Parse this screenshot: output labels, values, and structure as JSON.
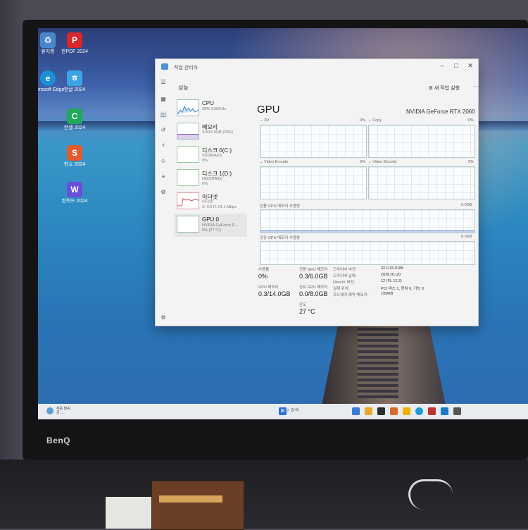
{
  "desktop": {
    "icons": [
      {
        "label": "휴지통",
        "icon": "recycle-bin-icon",
        "color": "#4c88c9"
      },
      {
        "label": "한PDF 2024",
        "icon": "pdf-icon",
        "color": "#d8262a"
      },
      {
        "label": "Microsoft Edge",
        "icon": "edge-icon",
        "color": "#1b8fd6"
      },
      {
        "label": "한글 2024",
        "icon": "hangul-icon",
        "color": "#3ba3e6"
      },
      {
        "label": "한셀 2024",
        "icon": "hancell-icon",
        "color": "#21a85b"
      },
      {
        "label": "한쇼 2024",
        "icon": "hanshow-icon",
        "color": "#e45b2b"
      },
      {
        "label": "한워드 2024",
        "icon": "hanword-icon",
        "color": "#6a4fd8"
      }
    ]
  },
  "window": {
    "title": "작업 관리자",
    "controls": [
      "–",
      "□",
      "✕"
    ],
    "page_heading": "성능",
    "run_task_label": "새 작업 실행",
    "more_label": "···"
  },
  "sidebar": {
    "items": [
      {
        "name": "CPU",
        "sub1": "29% 3.58GHz",
        "sub2": ""
      },
      {
        "name": "메모리",
        "sub1": "3.9/15.9GB (25%)",
        "sub2": ""
      },
      {
        "name": "디스크 0(C:)",
        "sub1": "SSD(RAID)",
        "sub2": "0%"
      },
      {
        "name": "디스크 1(D:)",
        "sub1": "HDD(RAID)",
        "sub2": "0%"
      },
      {
        "name": "이더넷",
        "sub1": "이더넷",
        "sub2": "S: 0.9 R: 61.1 Mbps"
      },
      {
        "name": "GPU 0",
        "sub1": "NVIDIA GeForce R...",
        "sub2": "0% (27 °C)"
      }
    ]
  },
  "gpu": {
    "title": "GPU",
    "model": "NVIDIA GeForce RTX 2060",
    "engines": [
      {
        "name": "3D",
        "value": "0%"
      },
      {
        "name": "Copy",
        "value": "0%"
      },
      {
        "name": "Video Encode",
        "value": "0%"
      },
      {
        "name": "Video Decode",
        "value": "0%"
      }
    ],
    "dedicated_label": "전용 GPU 메모리 사용량",
    "dedicated_max": "6.0GB",
    "shared_label": "공유 GPU 메모리 사용량",
    "shared_max": "8.0GB",
    "stats": {
      "util_label": "사용률",
      "util_value": "0%",
      "ded_label": "전용 GPU 메모리",
      "ded_value": "0.3/6.0GB",
      "gpumem_label": "GPU 메모리",
      "gpumem_value": "0.3/14.0GB",
      "shared_label": "공유 GPU 메모리",
      "shared_value": "0.0/8.0GB",
      "temp_label": "온도",
      "temp_value": "27 °C"
    },
    "details": [
      {
        "label": "드라이버 버전:",
        "value": "32.0.15.9186"
      },
      {
        "label": "드라이버 날짜:",
        "value": "2026-01-20"
      },
      {
        "label": "DirectX 버전:",
        "value": "12 (FL 12.2)"
      },
      {
        "label": "실제 위치:",
        "value": "PCI 버스 1, 장치 0, 기능 0"
      },
      {
        "label": "하드웨어 예약 메모리:",
        "value": "199MB"
      }
    ]
  },
  "taskbar": {
    "weather_line1": "추운 날씨",
    "weather_line2": "곧 ...",
    "search_placeholder": "검색",
    "app_colors": [
      "#2f6fd8",
      "#3a7bd5",
      "#e9a82a",
      "#2b2b2b",
      "#f0b400",
      "#1c9bd7",
      "#b33",
      "#1a7bc4",
      "#555"
    ]
  },
  "monitor": {
    "brand": "BenQ"
  }
}
